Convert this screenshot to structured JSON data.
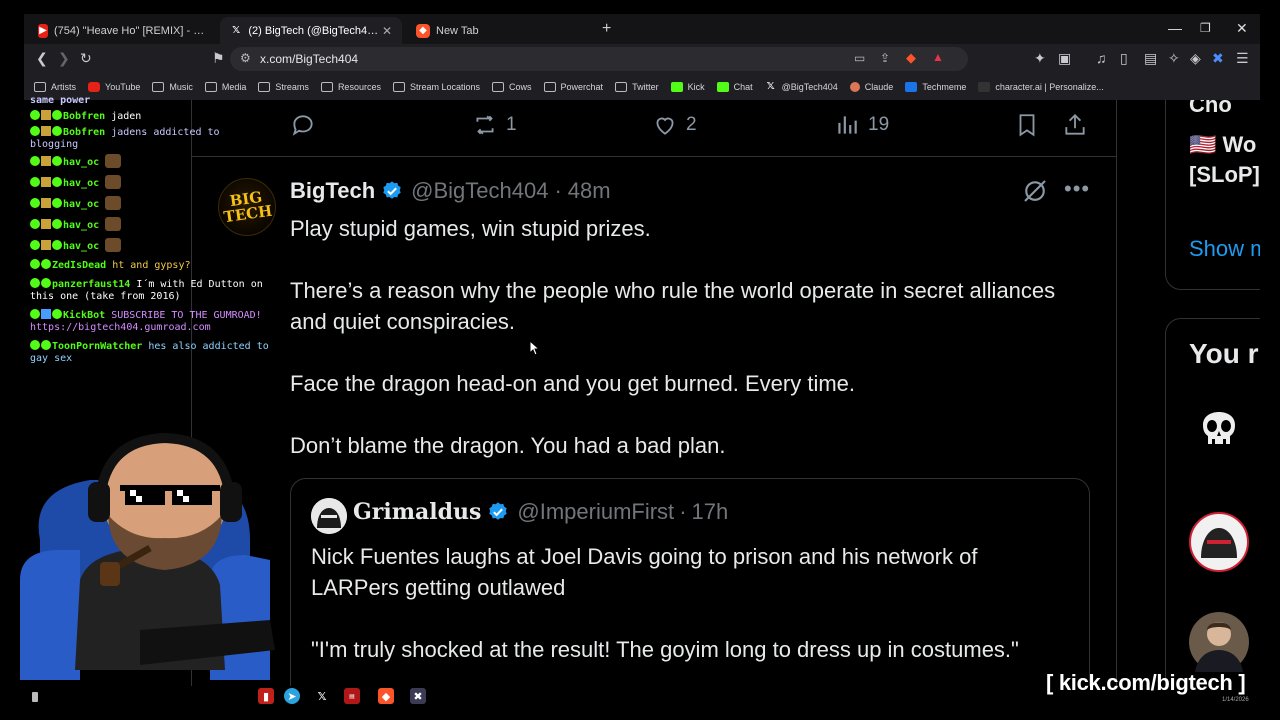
{
  "browser": {
    "tabs": [
      {
        "label": "(754) \"Heave Ho\" [REMIX] - Original by Stev",
        "icon": "youtube-icon",
        "active": false
      },
      {
        "label": "(2) BigTech (@BigTech404) / X",
        "icon": "x-icon",
        "active": true
      },
      {
        "label": "New Tab",
        "icon": "brave-icon",
        "active": false
      }
    ],
    "url": "x.com/BigTech404",
    "bookmarks": [
      "Artists",
      "YouTube",
      "Music",
      "Media",
      "Streams",
      "Resources",
      "Stream Locations",
      "Cows",
      "Powerchat",
      "Twitter",
      "Kick",
      "Chat",
      "@BigTech404",
      "Claude",
      "Techmeme",
      "character.ai | Personalize..."
    ]
  },
  "chat": {
    "truncated_top": "same power",
    "messages": [
      {
        "user": "Bobfren",
        "text": "jaden",
        "user_color": "#53fc18",
        "text_color": "#ffffff"
      },
      {
        "user": "Bobfren",
        "text": "jadens addicted to blogging",
        "user_color": "#53fc18",
        "text_color": "#c9c9ff"
      },
      {
        "user": "hav_oc",
        "text": "",
        "user_color": "#53fc18",
        "text_color": "#ffffff"
      },
      {
        "user": "hav_oc",
        "text": "",
        "user_color": "#53fc18",
        "text_color": "#ffffff"
      },
      {
        "user": "hav_oc",
        "text": "",
        "user_color": "#53fc18",
        "text_color": "#ffffff"
      },
      {
        "user": "hav_oc",
        "text": "",
        "user_color": "#53fc18",
        "text_color": "#ffffff"
      },
      {
        "user": "hav_oc",
        "text": "",
        "user_color": "#53fc18",
        "text_color": "#ffffff"
      },
      {
        "user": "ZedIsDead",
        "text": "ht and gypsy?",
        "user_color": "#53fc18",
        "text_color": "#f2c94c"
      },
      {
        "user": "panzerfaust14",
        "text": "I´m with Ed Dutton on this one (take from 2016)",
        "user_color": "#53fc18",
        "text_color": "#ffffff"
      },
      {
        "user": "KickBot",
        "text": "SUBSCRIBE TO THE GUMROAD! https://bigtech404.gumroad.com",
        "user_color": "#53fc18",
        "text_color": "#d58cff"
      },
      {
        "user": "ToonPornWatcher",
        "text": "hes also addicted to gay sex",
        "user_color": "#53fc18",
        "text_color": "#8fd3ff"
      }
    ]
  },
  "actions": {
    "reply_count": "1",
    "like_count": "2",
    "views_count": "19"
  },
  "tweet": {
    "avatar_text": "BIG TECH",
    "name": "BigTech",
    "handle": "@BigTech404",
    "dot": "·",
    "time": "48m",
    "paragraphs": [
      "Play stupid games, win stupid prizes.",
      "There’s a reason why the people who rule the world operate in secret alliances and quiet conspiracies.",
      "Face the dragon head-on and you get burned. Every time.",
      "Don’t blame the dragon. You had a bad plan."
    ]
  },
  "quote": {
    "name": "Grimaldus",
    "handle": "@ImperiumFirst",
    "dot": "·",
    "time": "17h",
    "paragraphs": [
      "Nick Fuentes laughs at Joel Davis going to prison and his network of LARPers getting outlawed",
      "\"I'm truly shocked at the result! The goyim long to dress up in costumes.\""
    ]
  },
  "sidebar": {
    "top_text": "Cho",
    "trend_text": "🇺🇸 Wo",
    "trend_text2": "[SLoP]",
    "show_more": "Show m",
    "who_to_follow": "You r"
  },
  "overlay": {
    "kick_url": "[ kick.com/bigtech ]",
    "date": "1/14/2026"
  },
  "colors": {
    "accent": "#1d9bf0",
    "kick_green": "#53fc18",
    "muted": "#71767b",
    "border": "#2f3336"
  }
}
